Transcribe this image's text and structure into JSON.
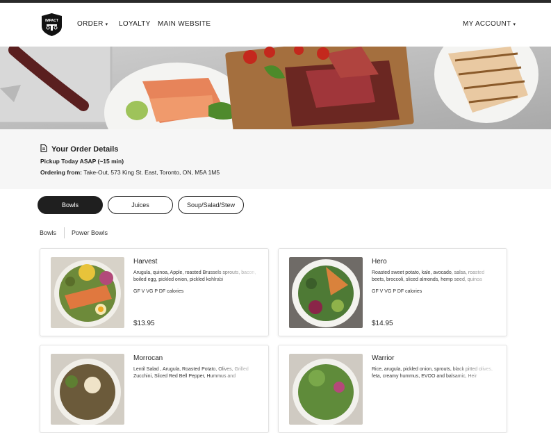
{
  "colors": {
    "header_bar": "#2a2a2a",
    "active_pill": "#1f1f1f",
    "details_bg": "#f6f6f6"
  },
  "nav": {
    "logo_text": "IMPACT",
    "items": [
      {
        "label": "ORDER"
      },
      {
        "label": "LOYALTY"
      },
      {
        "label": "MAIN WEBSITE"
      }
    ],
    "account_label": "MY ACCOUNT"
  },
  "order_details": {
    "title": "Your Order Details",
    "pickup": "Pickup Today ASAP (~15 min)",
    "ordering_from_label": "Ordering from:",
    "ordering_from_value": "Take-Out, 573 King St. East, Toronto, ON, M5A 1M5"
  },
  "categories": [
    {
      "label": "Bowls",
      "active": true
    },
    {
      "label": "Juices",
      "active": false
    },
    {
      "label": "Soup/Salad/Stew",
      "active": false
    }
  ],
  "subcategories": [
    {
      "label": "Bowls"
    },
    {
      "label": "Power Bowls"
    }
  ],
  "menu_items": [
    {
      "name": "Harvest",
      "description": "Arugula, quinoa, Apple, roasted Brussels sprouts, bacon, boiled egg, pickled onion, pickled kohlrabi",
      "tags": "GF V VG P DF calories",
      "price": "$13.95"
    },
    {
      "name": "Hero",
      "description": "Roasted sweet potato, kale, avocado, salsa, roasted beets, broccoli, sliced almonds, hemp seed, quinoa",
      "tags": "GF V VG P DF calories",
      "price": "$14.95"
    },
    {
      "name": "Morrocan",
      "description": "Lentil Salad , Arugula, Roasted Potato, Olives, Grilled Zucchini, Sliced Red Bell Pepper, Hummus and",
      "tags": "",
      "price": ""
    },
    {
      "name": "Warrior",
      "description": "Rice, arugula, pickled onion, sprouts, black pitted olives, feta, creamy hummus, EVOO and balsamic, Heir",
      "tags": "",
      "price": ""
    }
  ]
}
